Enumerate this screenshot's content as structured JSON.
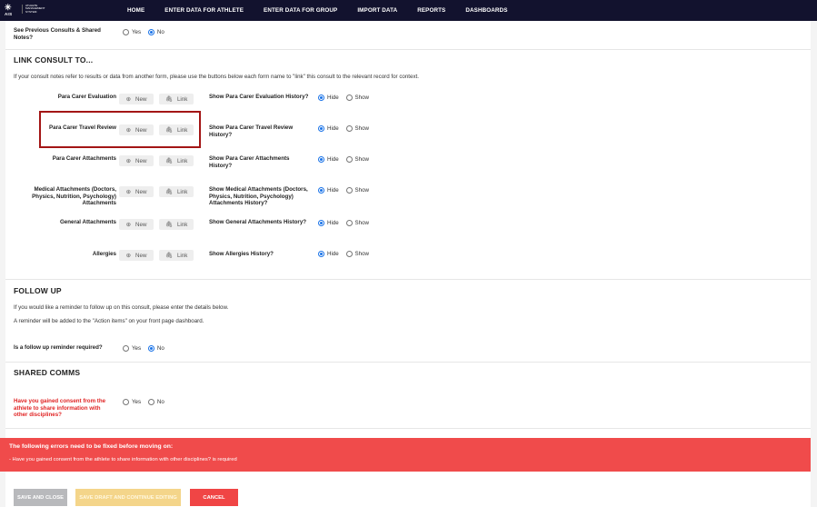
{
  "header": {
    "logo_mark": "AIS",
    "logo_text": "ATHLETE MANAGEMENT SYSTEM",
    "nav": [
      "HOME",
      "ENTER DATA FOR ATHLETE",
      "ENTER DATA FOR GROUP",
      "IMPORT DATA",
      "REPORTS",
      "DASHBOARDS"
    ]
  },
  "consults": {
    "label": "See Previous Consults & Shared Notes?",
    "yes": "Yes",
    "no": "No",
    "selected": "No"
  },
  "link_section": {
    "title": "LINK CONSULT TO...",
    "description": "If your consult notes refer to results or data from another form, please use the buttons below each form name to \"link\" this consult to the relevant record for context.",
    "new_label": "New",
    "link_label": "Link",
    "hide_label": "Hide",
    "show_label": "Show",
    "rows": [
      {
        "name": "Para Carer Evaluation",
        "history": "Show Para Carer Evaluation History?",
        "selected": "Hide"
      },
      {
        "name": "Para Carer Travel Review",
        "history": "Show Para Carer Travel Review History?",
        "selected": "Hide"
      },
      {
        "name": "Para Carer Attachments",
        "history": "Show Para Carer Attachments History?",
        "selected": "Hide"
      },
      {
        "name": "Medical Attachments (Doctors, Physics, Nutrition, Psychology) Attachments",
        "history": "Show Medical Attachments (Doctors, Physics, Nutrition, Psychology) Attachments History?",
        "selected": "Hide"
      },
      {
        "name": "General Attachments",
        "history": "Show General Attachments History?",
        "selected": "Hide"
      },
      {
        "name": "Allergies",
        "history": "Show Allergies History?",
        "selected": "Hide"
      }
    ]
  },
  "follow_up": {
    "title": "FOLLOW UP",
    "line1": "If you would like a reminder to follow up on this consult, please enter the details below.",
    "line2": "A reminder will be added to the \"Action items\" on your front page dashboard.",
    "question": "Is a follow up reminder required?",
    "yes": "Yes",
    "no": "No",
    "selected": "No"
  },
  "shared_comms": {
    "title": "SHARED COMMS",
    "question": "Have you gained consent from the athlete to share information with other disciplines?",
    "yes": "Yes",
    "no": "No",
    "selected": ""
  },
  "errors": {
    "title": "The following errors need to be fixed before moving on:",
    "items": [
      "- Have you gained consent from the athlete to share information with other disciplines? is required"
    ]
  },
  "footer": {
    "save_close": "SAVE AND CLOSE",
    "save_draft": "SAVE DRAFT AND CONTINUE EDITING",
    "cancel": "CANCEL"
  },
  "colors": {
    "nav_bg": "#12122e",
    "error_bg": "#f04b4b",
    "highlight": "#a31515",
    "radio_on": "#1a73e8",
    "save_close": "#b8b9bc",
    "save_draft": "#f4d58a",
    "cancel": "#f04545"
  },
  "icons": {
    "new": "plus-circle-icon",
    "link": "paperclip-icon"
  }
}
